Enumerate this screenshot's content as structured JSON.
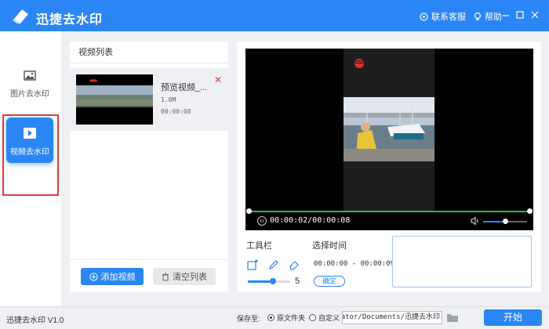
{
  "app": {
    "title": "迅捷去水印",
    "support_label": "联系客服",
    "help_label": "帮助"
  },
  "nav": {
    "items": [
      {
        "label": "图片去水印",
        "icon": "image-icon",
        "active": false
      },
      {
        "label": "视频去水印",
        "icon": "play-icon",
        "active": true
      }
    ]
  },
  "video_list": {
    "header": "视频列表",
    "items": [
      {
        "name": "预览视频_...",
        "size": "1.0M",
        "duration": "00:00:08"
      }
    ],
    "add_label": "添加视频",
    "clear_label": "清空列表"
  },
  "player": {
    "current_time": "00:00:02",
    "total_time": "00:00:08",
    "time_display": "00:00:02/00:00:08",
    "progress": 0.0,
    "volume": 0.5
  },
  "toolbar": {
    "title": "工具栏",
    "brush_size": "5",
    "tools": [
      "select-rect-icon",
      "pen-icon",
      "eraser-icon"
    ]
  },
  "time_select": {
    "title": "选择时间",
    "range": "00:00:00 - 00:00:09",
    "confirm_label": "确定"
  },
  "footer": {
    "version": "迅捷去水印 V1.0",
    "save_to_label": "保存至:",
    "options": [
      {
        "label": "原文件夹",
        "selected": true
      },
      {
        "label": "自定义",
        "selected": false
      }
    ],
    "path": "istrator/Documents/迅捷去水印",
    "start_label": "开始"
  },
  "colors": {
    "accent": "#2b86f5",
    "progress": "#2ec12e",
    "highlight_border": "#e23a3a"
  }
}
